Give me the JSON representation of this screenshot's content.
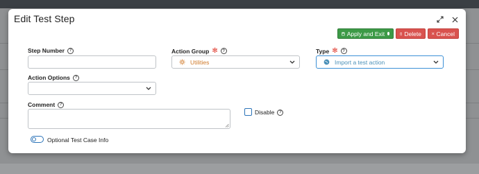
{
  "dialog": {
    "title": "Edit Test Step"
  },
  "toolbar": {
    "apply_label": "Apply and Exit",
    "delete_label": "Delete",
    "cancel_label": "Cancel"
  },
  "fields": {
    "step_number": {
      "label": "Step Number",
      "value": ""
    },
    "action_group": {
      "label": "Action Group",
      "value": "Utilities",
      "required": true
    },
    "type": {
      "label": "Type",
      "value": "Import a test action",
      "required": true
    },
    "action_options": {
      "label": "Action Options",
      "value": ""
    },
    "comment": {
      "label": "Comment",
      "value": ""
    },
    "disable": {
      "label": "Disable",
      "checked": false
    },
    "optional_info": {
      "label": "Optional Test Case Info",
      "on": false
    }
  },
  "icons": [
    "expand-icon",
    "close-icon",
    "save-icon",
    "trash-icon",
    "x-icon",
    "help-icon",
    "gear-icon",
    "globe-icon",
    "chevron-down-icon"
  ],
  "colors": {
    "apply_green": "#3d9a47",
    "danger_red": "#d9534f",
    "required_red": "#e03b2f",
    "accent_blue": "#2b73b8",
    "utilities_orange": "#d07a2a",
    "type_teal": "#4a90b8"
  }
}
